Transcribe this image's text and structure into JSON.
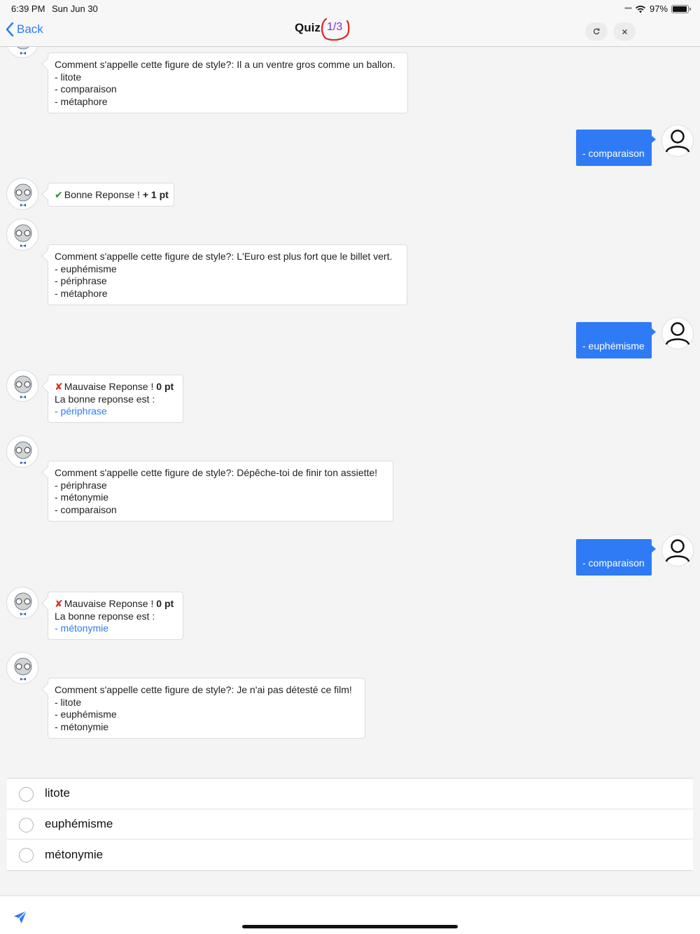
{
  "status_bar": {
    "time": "6:39 PM",
    "date": "Sun Jun 30",
    "battery": "97%"
  },
  "nav": {
    "back_label": "Back",
    "title": "Quiz",
    "progress": "1/3",
    "refresh_icon": "refresh-icon",
    "close_icon": "close-icon"
  },
  "messages": {
    "q1": {
      "prompt": "Comment s'appelle cette figure de style?: Il a un ventre gros comme un ballon.",
      "options": [
        "- litote",
        "- comparaison",
        "- métaphore"
      ]
    },
    "a1": "- comparaison",
    "r1": {
      "text": "Bonne Reponse ! ",
      "points": "+ 1 pt"
    },
    "q2": {
      "prompt": "Comment s'appelle cette figure de style?: L'Euro est plus fort que le billet vert.",
      "options": [
        "- euphémisme",
        "- périphrase",
        "- métaphore"
      ]
    },
    "a2": "- euphémisme",
    "r2": {
      "text": "Mauvaise Reponse ! ",
      "points": "0 pt",
      "hint": "La bonne reponse est :",
      "correct": "- périphrase"
    },
    "q3": {
      "prompt": "Comment s'appelle cette figure de style?: Dépêche-toi de finir ton assiette!",
      "options": [
        "- périphrase",
        "- métonymie",
        "- comparaison"
      ]
    },
    "a3": "- comparaison",
    "r3": {
      "text": "Mauvaise Reponse ! ",
      "points": "0 pt",
      "hint": "La bonne reponse est :",
      "correct": "- métonymie"
    },
    "q4": {
      "prompt": "Comment s'appelle cette figure de style?: Je n'ai pas détesté ce film!",
      "options": [
        "- litote",
        "- euphémisme",
        "- métonymie"
      ]
    }
  },
  "answer_options": [
    "litote",
    "euphémisme",
    "métonymie"
  ],
  "marks": {
    "ok": "✔",
    "bad": "✘"
  },
  "colors": {
    "accent": "#2f7bf5",
    "progress": "#7a2fd6",
    "progress_ring": "#e0261f",
    "correct": "#2e8b2e",
    "wrong": "#d9312b"
  },
  "icons": {
    "send": "send-icon",
    "bot_avatar": "professor-avatar-icon",
    "user_avatar": "user-avatar-icon"
  }
}
